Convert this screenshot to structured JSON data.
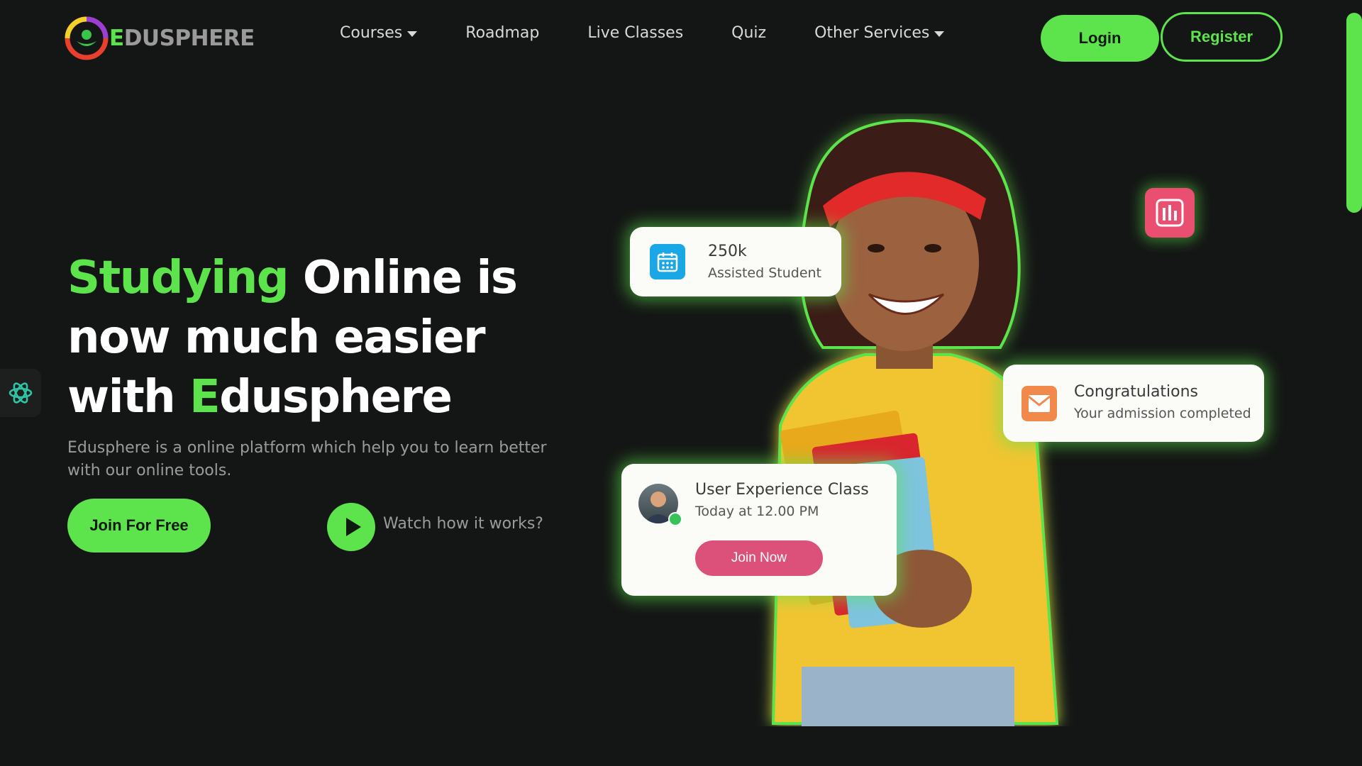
{
  "brand": {
    "name_first": "E",
    "name_rest": "DUSPHERE"
  },
  "nav": {
    "items": [
      {
        "label": "Courses",
        "dropdown": true
      },
      {
        "label": "Roadmap",
        "dropdown": false
      },
      {
        "label": "Live Classes",
        "dropdown": false
      },
      {
        "label": "Quiz",
        "dropdown": false
      },
      {
        "label": "Other Services",
        "dropdown": true
      }
    ],
    "login_label": "Login",
    "register_label": "Register"
  },
  "hero": {
    "headline": {
      "w1": "Studying",
      "w2": " Online is",
      "line2": "now much easier",
      "w3": "with ",
      "w4": "E",
      "w5": "dusphere"
    },
    "subtitle": "Edusphere is a online platform which help you to learn better with our online tools.",
    "join_label": "Join For Free",
    "watch_label": "Watch how it works?"
  },
  "cards": {
    "students": {
      "value": "250k",
      "label": "Assisted Student"
    },
    "congrats": {
      "title": "Congratulations",
      "subtitle": "Your admission completed"
    },
    "class": {
      "title": "User Experience Class",
      "time": "Today at 12.00 PM",
      "button": "Join Now"
    }
  },
  "colors": {
    "accent": "#5de34b",
    "background": "#141615",
    "pink": "#dc5179",
    "calendar": "#1aa7e6",
    "mail": "#f0894a"
  },
  "icons": [
    "calendar-icon",
    "mail-icon",
    "chart-icon",
    "play-icon",
    "openai-icon",
    "caret-down-icon"
  ]
}
